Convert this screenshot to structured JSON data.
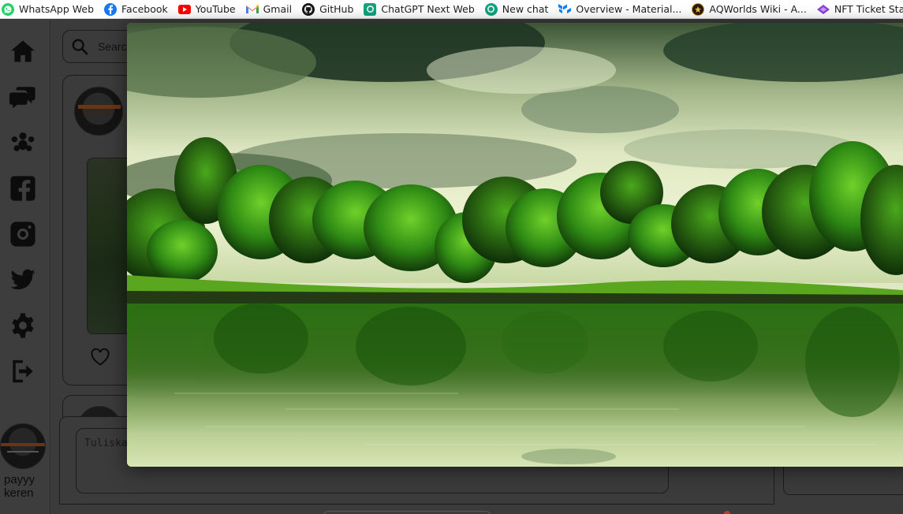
{
  "bookmarks": [
    {
      "label": "WhatsApp Web",
      "icon": "whatsapp-icon",
      "color": "#25d366"
    },
    {
      "label": "Facebook",
      "icon": "facebook-icon",
      "color": "#1877f2"
    },
    {
      "label": "YouTube",
      "icon": "youtube-icon",
      "color": "#ff0000"
    },
    {
      "label": "Gmail",
      "icon": "gmail-icon",
      "color": "#ea4335"
    },
    {
      "label": "GitHub",
      "icon": "github-icon",
      "color": "#181717"
    },
    {
      "label": "ChatGPT Next Web",
      "icon": "chatgpt-icon",
      "color": "#10a37f"
    },
    {
      "label": "New chat",
      "icon": "openai-icon",
      "color": "#10a37f"
    },
    {
      "label": "Overview - Material...",
      "icon": "material-ui-icon",
      "color": "#007fff"
    },
    {
      "label": "AQWorlds Wiki - A...",
      "icon": "aqworlds-icon",
      "color": "#5a3a1a"
    },
    {
      "label": "NFT Ticket Staging",
      "icon": "nft-icon",
      "color": "#8b3fd9"
    }
  ],
  "sidebar": {
    "items": [
      {
        "name": "home-icon"
      },
      {
        "name": "chat-icon"
      },
      {
        "name": "community-icon"
      },
      {
        "name": "facebook-icon"
      },
      {
        "name": "instagram-icon"
      },
      {
        "name": "twitter-icon"
      },
      {
        "name": "settings-icon"
      },
      {
        "name": "logout-icon"
      }
    ],
    "profile_name": "payyy keren"
  },
  "search": {
    "placeholder": "Search"
  },
  "comment": {
    "placeholder": "Tuliska"
  },
  "lightbox": {
    "image_subject": "landscape-lake-trees-reflection"
  },
  "colors": {
    "overlay_background": "#3b3b3b",
    "icon_fill": "#0c0c0c",
    "border": "#1c1c1c"
  }
}
